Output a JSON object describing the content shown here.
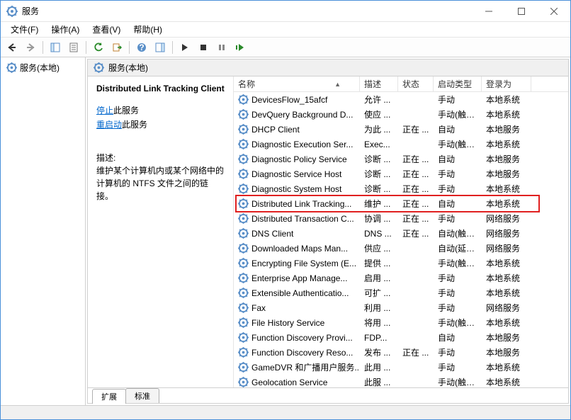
{
  "window": {
    "title": "服务"
  },
  "menu": {
    "file": "文件(F)",
    "action": "操作(A)",
    "view": "查看(V)",
    "help": "帮助(H)"
  },
  "tree": {
    "root": "服务(本地)"
  },
  "paneheader": "服务(本地)",
  "detail": {
    "selected": "Distributed Link Tracking Client",
    "stop_link": "停止",
    "stop_suffix": "此服务",
    "restart_link": "重启动",
    "restart_suffix": "此服务",
    "desc_label": "描述:",
    "desc_body": "维护某个计算机内或某个网络中的计算机的 NTFS 文件之间的链接。"
  },
  "columns": {
    "name": "名称",
    "desc": "描述",
    "status": "状态",
    "startup": "启动类型",
    "logon": "登录为"
  },
  "services": [
    {
      "name": "DevicesFlow_15afcf",
      "desc": "允许 ...",
      "status": "",
      "startup": "手动",
      "logon": "本地系统"
    },
    {
      "name": "DevQuery Background D...",
      "desc": "使应 ...",
      "status": "",
      "startup": "手动(触发...",
      "logon": "本地系统"
    },
    {
      "name": "DHCP Client",
      "desc": "为此 ...",
      "status": "正在 ...",
      "startup": "自动",
      "logon": "本地服务"
    },
    {
      "name": "Diagnostic Execution Ser...",
      "desc": "Exec...",
      "status": "",
      "startup": "手动(触发...",
      "logon": "本地系统"
    },
    {
      "name": "Diagnostic Policy Service",
      "desc": "诊断 ...",
      "status": "正在 ...",
      "startup": "自动",
      "logon": "本地服务"
    },
    {
      "name": "Diagnostic Service Host",
      "desc": "诊断 ...",
      "status": "正在 ...",
      "startup": "手动",
      "logon": "本地服务"
    },
    {
      "name": "Diagnostic System Host",
      "desc": "诊断 ...",
      "status": "正在 ...",
      "startup": "手动",
      "logon": "本地系统"
    },
    {
      "name": "Distributed Link Tracking...",
      "desc": "维护 ...",
      "status": "正在 ...",
      "startup": "自动",
      "logon": "本地系统"
    },
    {
      "name": "Distributed Transaction C...",
      "desc": "协调 ...",
      "status": "正在 ...",
      "startup": "手动",
      "logon": "网络服务"
    },
    {
      "name": "DNS Client",
      "desc": "DNS ...",
      "status": "正在 ...",
      "startup": "自动(触发...",
      "logon": "网络服务"
    },
    {
      "name": "Downloaded Maps Man...",
      "desc": "供应 ...",
      "status": "",
      "startup": "自动(延迟...",
      "logon": "网络服务"
    },
    {
      "name": "Encrypting File System (E...",
      "desc": "提供 ...",
      "status": "",
      "startup": "手动(触发...",
      "logon": "本地系统"
    },
    {
      "name": "Enterprise App Manage...",
      "desc": "启用 ...",
      "status": "",
      "startup": "手动",
      "logon": "本地系统"
    },
    {
      "name": "Extensible Authenticatio...",
      "desc": "可扩 ...",
      "status": "",
      "startup": "手动",
      "logon": "本地系统"
    },
    {
      "name": "Fax",
      "desc": "利用 ...",
      "status": "",
      "startup": "手动",
      "logon": "网络服务"
    },
    {
      "name": "File History Service",
      "desc": "将用 ...",
      "status": "",
      "startup": "手动(触发...",
      "logon": "本地系统"
    },
    {
      "name": "Function Discovery Provi...",
      "desc": "FDP...",
      "status": "",
      "startup": "自动",
      "logon": "本地服务"
    },
    {
      "name": "Function Discovery Reso...",
      "desc": "发布 ...",
      "status": "正在 ...",
      "startup": "手动",
      "logon": "本地服务"
    },
    {
      "name": "GameDVR 和广播用户服务...",
      "desc": "此用 ...",
      "status": "",
      "startup": "手动",
      "logon": "本地系统"
    },
    {
      "name": "Geolocation Service",
      "desc": "此服 ...",
      "status": "",
      "startup": "手动(触发...",
      "logon": "本地系统"
    }
  ],
  "highlighted_index": 7,
  "tabs": {
    "extended": "扩展",
    "standard": "标准"
  }
}
